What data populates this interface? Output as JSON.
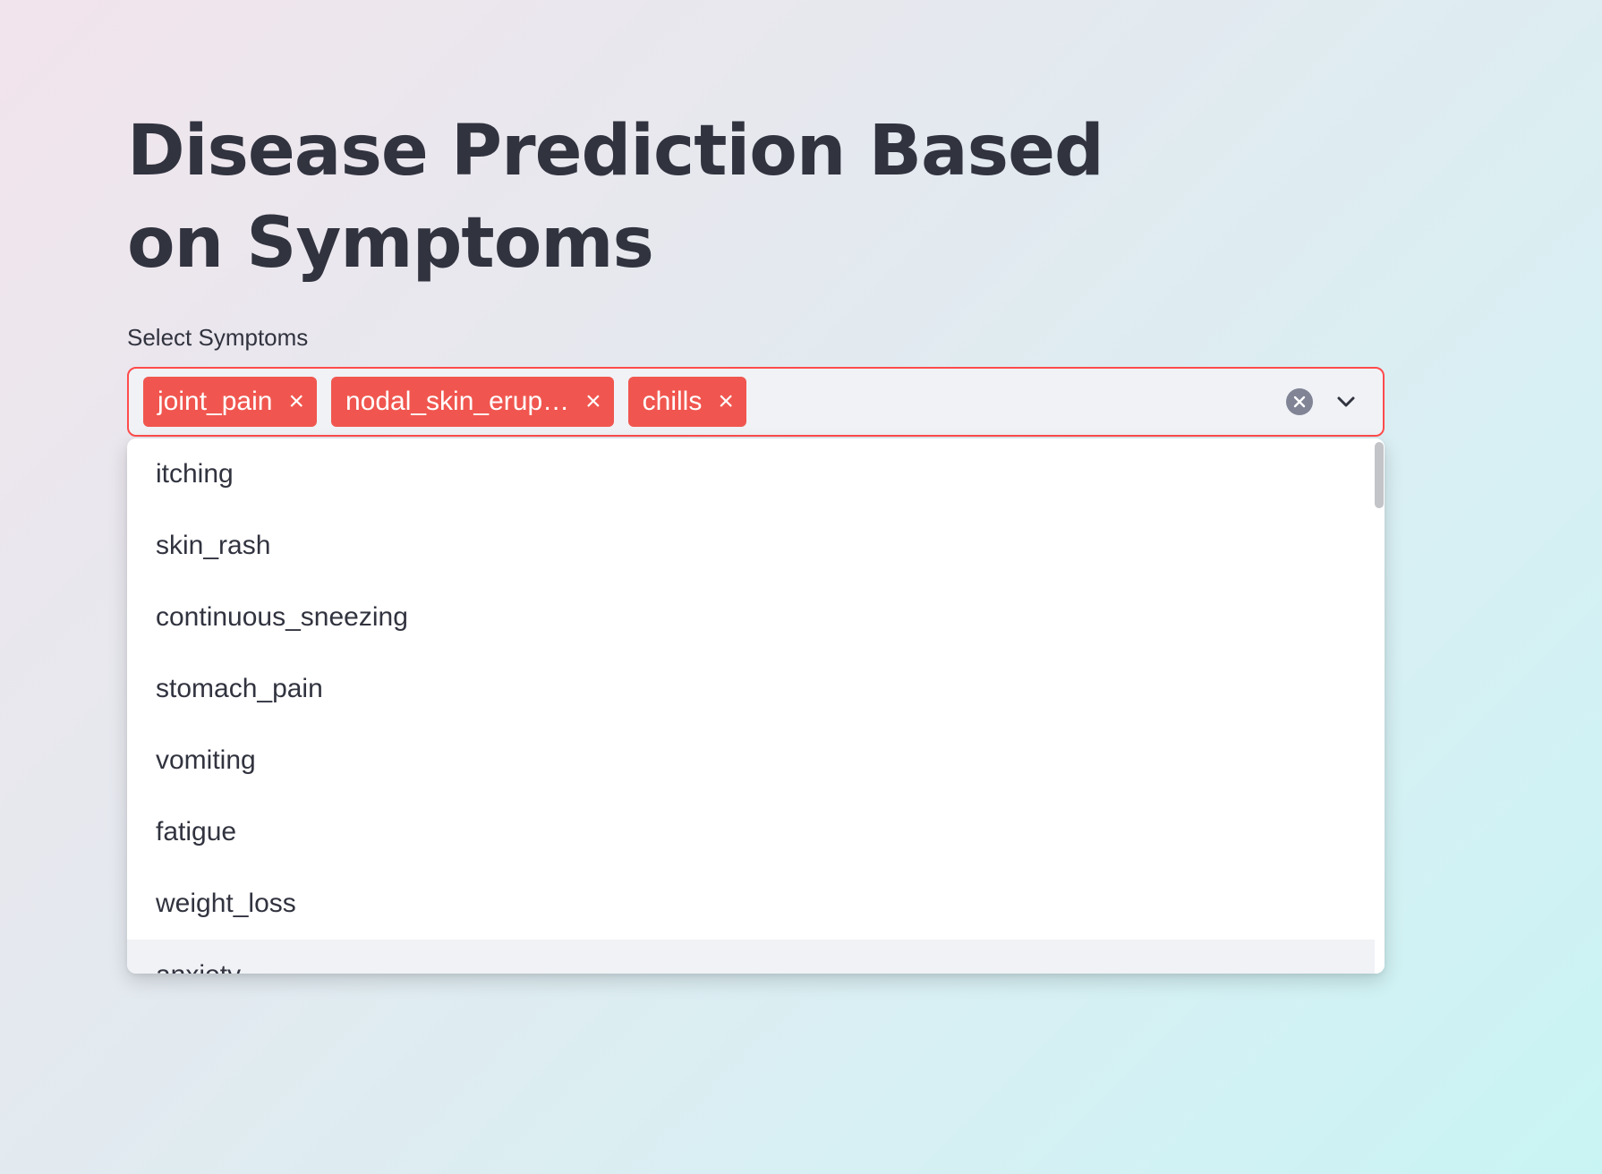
{
  "page": {
    "title": "Disease Prediction Based on Symptoms"
  },
  "symptom_select": {
    "label": "Select Symptoms",
    "selected": [
      {
        "label": "joint_pain",
        "remove_glyph": "×"
      },
      {
        "label": "nodal_skin_erup…",
        "remove_glyph": "×"
      },
      {
        "label": "chills",
        "remove_glyph": "×"
      }
    ],
    "clear_icon": "clear-icon",
    "toggle_icon": "chevron-down-icon",
    "accent_color": "#ff4b4b",
    "options": [
      "itching",
      "skin_rash",
      "continuous_sneezing",
      "stomach_pain",
      "vomiting",
      "fatigue",
      "weight_loss",
      "anxiety"
    ],
    "highlighted_option": "anxiety"
  }
}
